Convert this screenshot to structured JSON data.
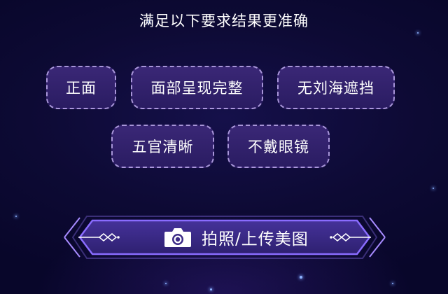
{
  "title": "满足以下要求结果更准确",
  "requirements": [
    "正面",
    "面部呈现完整",
    "无刘海遮挡",
    "五官清晰",
    "不戴眼镜"
  ],
  "upload_button": {
    "label": "拍照/上传美图",
    "icon": "camera-icon"
  },
  "colors": {
    "background": "#0d0a34",
    "tag_fill": "#3a2776",
    "tag_border": "#d2beff",
    "button_fill": "#3b2a86",
    "button_border": "#8a6cff"
  }
}
